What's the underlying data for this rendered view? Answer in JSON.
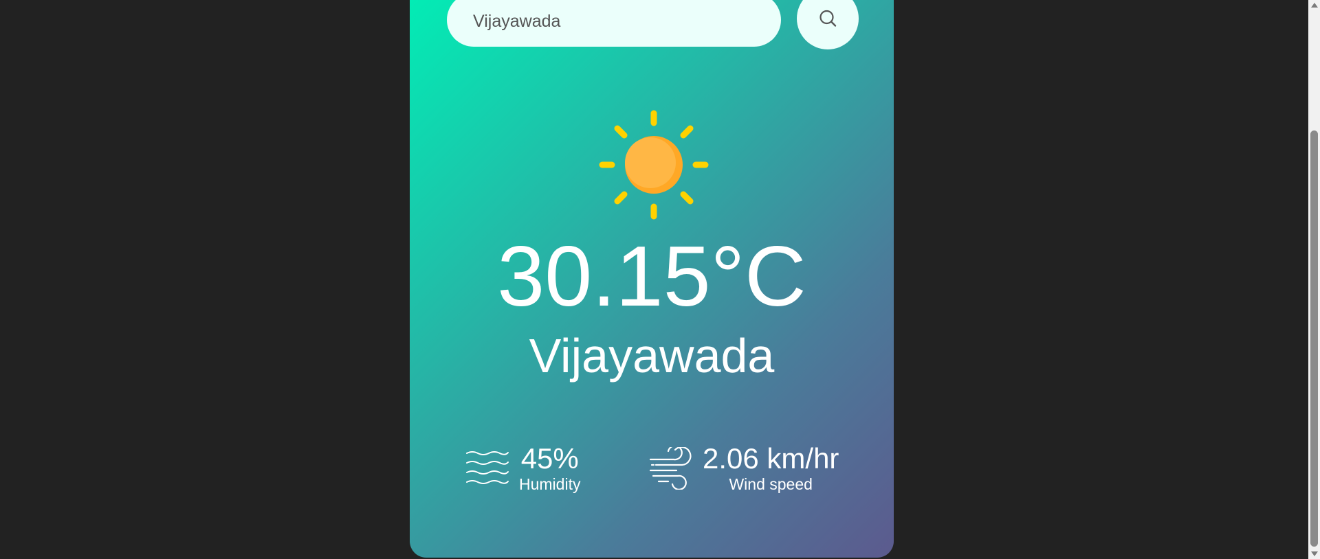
{
  "search": {
    "value": "Vijayawada",
    "icon": "search-icon"
  },
  "weather": {
    "icon": "sun-icon",
    "temperature": "30.15°C",
    "city": "Vijayawada"
  },
  "stats": {
    "humidity": {
      "icon": "humidity-waves-icon",
      "value": "45%",
      "label": "Humidity"
    },
    "wind": {
      "icon": "wind-icon",
      "value": "2.06 km/hr",
      "label": "Wind speed"
    }
  },
  "colors": {
    "page_background": "#222222",
    "gradient_start": "#00f0b6",
    "gradient_end": "#5c5a8e",
    "sun_body": "#ffb13b",
    "sun_rays": "#ffd200",
    "text": "#ffffff"
  }
}
